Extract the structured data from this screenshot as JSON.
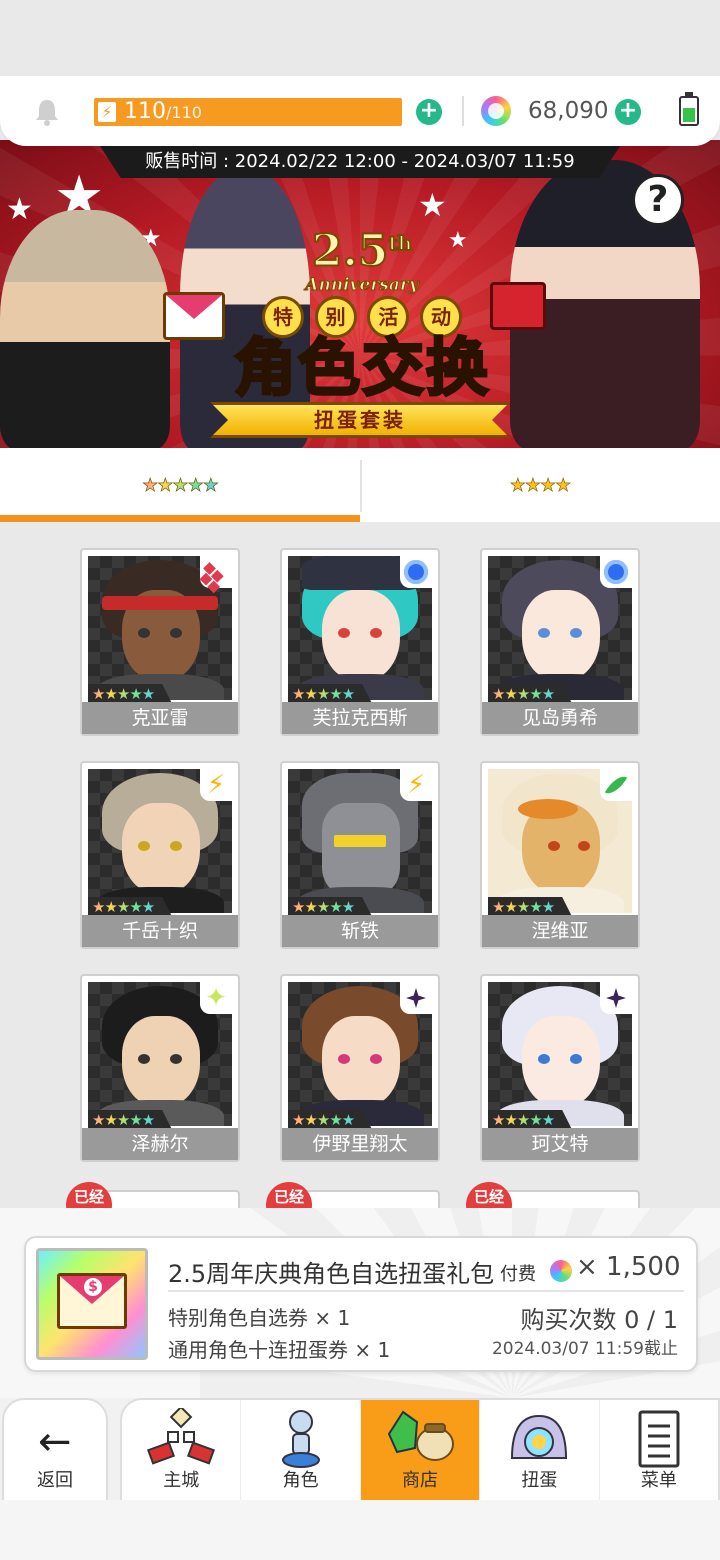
{
  "status": {
    "stamina_current": "110",
    "stamina_max": "110",
    "gems": "68,090"
  },
  "banner": {
    "sale_time": "贩售时间 : 2024.02/22 12:00 - 2024.03/07 11:59",
    "anniversary_number": "2.5",
    "anniversary_sup": "th",
    "anniversary_text": "Anniversary",
    "event_badges": [
      "特",
      "别",
      "活",
      "动"
    ],
    "title": "角色交换",
    "subtitle": "扭蛋套装",
    "help_label": "?"
  },
  "tabs": [
    {
      "label": "★★★★★",
      "rarity": 5,
      "active": true
    },
    {
      "label": "★★★★",
      "rarity": 4,
      "active": false
    }
  ],
  "characters": [
    {
      "name": "克亚雷",
      "stars": "★★★★★",
      "attribute": "diamond-icon"
    },
    {
      "name": "芙拉克西斯",
      "stars": "★★★★★",
      "attribute": "circle-icon"
    },
    {
      "name": "见岛勇希",
      "stars": "★★★★★",
      "attribute": "circle-icon"
    },
    {
      "name": "千岳十织",
      "stars": "★★★★★",
      "attribute": "bolt-icon"
    },
    {
      "name": "斩铁",
      "stars": "★★★★★",
      "attribute": "bolt-icon"
    },
    {
      "name": "涅维亚",
      "stars": "★★★★★",
      "attribute": "leaf-icon"
    },
    {
      "name": "泽赫尔",
      "stars": "★★★★★",
      "attribute": "sparkle-icon"
    },
    {
      "name": "伊野里翔太",
      "stars": "★★★★★",
      "attribute": "void-star-icon"
    },
    {
      "name": "珂艾特",
      "stars": "★★★★★",
      "attribute": "void-star-icon"
    }
  ],
  "owned_badge": "已经",
  "pack": {
    "title": "2.5周年庆典角色自选扭蛋礼包",
    "cost_label": "付费",
    "price": "× 1,500",
    "item1": "特别角色自选券 × 1",
    "item2": "通用角色十连扭蛋券 × 1",
    "purchase_limit": "购买次数 0 / 1",
    "deadline": "2024.03/07 11:59截止"
  },
  "nav": {
    "back": "返回",
    "items": [
      "主城",
      "角色",
      "商店",
      "扭蛋",
      "菜单"
    ]
  },
  "colors": {
    "accent_orange": "#f5921e",
    "plus_green": "#25b98a",
    "banner_red": "#b51a24"
  }
}
